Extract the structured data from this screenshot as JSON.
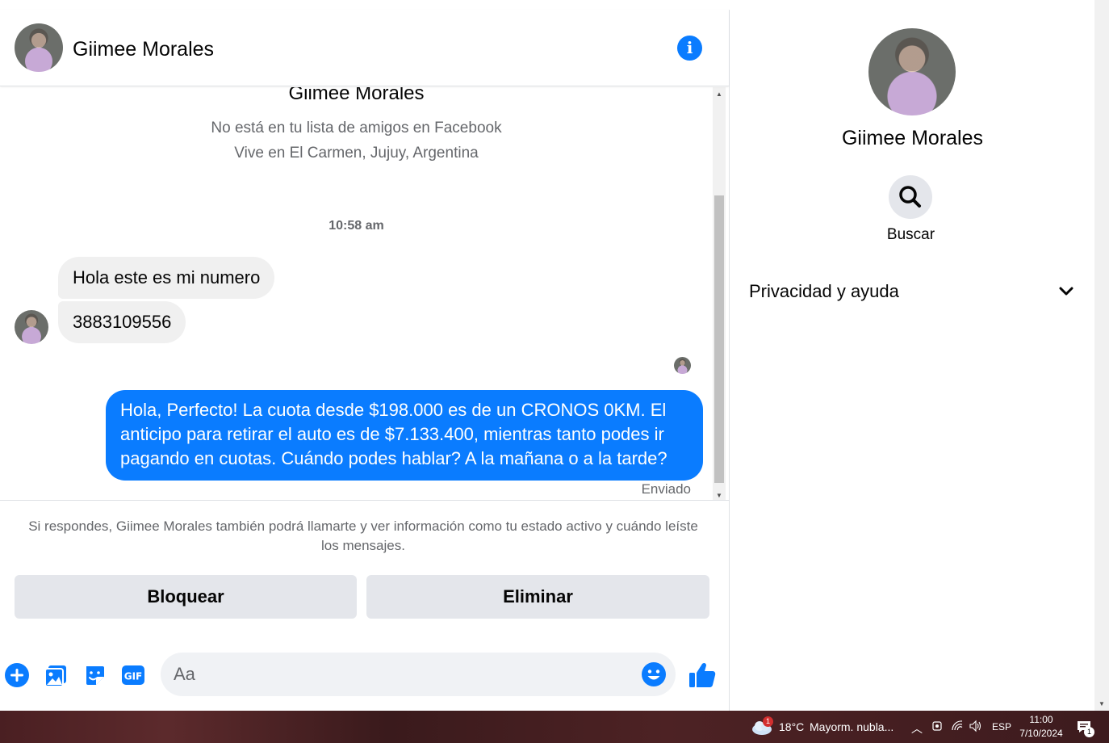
{
  "header": {
    "contact_name": "Giimee Morales"
  },
  "profile": {
    "name": "Giimee Morales",
    "line1": "No está en tu lista de amigos en Facebook",
    "line2": "Vive en El Carmen, Jujuy, Argentina"
  },
  "conversation": {
    "timestamp": "10:58 am",
    "incoming": [
      "Hola este es mi numero",
      "3883109556"
    ],
    "outgoing": "Hola, Perfecto! La cuota desde $198.000 es de un CRONOS 0KM. El anticipo para retirar el auto es de $7.133.400, mientras tanto podes ir pagando en cuotas. Cuándo podes hablar? A la mañana o a la tarde?",
    "status": "Enviado"
  },
  "notice": "Si respondes, Giimee Morales también podrá llamarte y ver información como tu estado activo y cuándo leíste los mensajes.",
  "actions": {
    "block_label": "Bloquear",
    "delete_label": "Eliminar"
  },
  "composer": {
    "placeholder": "Aa"
  },
  "sidebar": {
    "name": "Giimee Morales",
    "search_label": "Buscar",
    "privacy_label": "Privacidad y ayuda"
  },
  "taskbar": {
    "temperature": "18°C",
    "weather": "Mayorm. nubla...",
    "weather_badge": "1",
    "language": "ESP",
    "time": "11:00",
    "date": "7/10/2024",
    "notification_count": "1"
  },
  "colors": {
    "accent": "#0a7cff",
    "bubble_in": "#f0f0f0",
    "button_bg": "#e4e6eb",
    "muted_text": "#65676b"
  }
}
